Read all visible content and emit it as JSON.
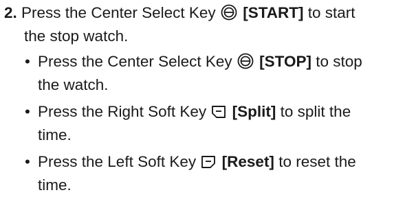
{
  "step": {
    "number": "2.",
    "line1_pre": "Press the Center Select Key",
    "line1_key": "[START]",
    "line1_post": "to start",
    "line2": "the stop watch.",
    "center_key_icon": "center-select-key-icon"
  },
  "bullets": [
    {
      "dot": "•",
      "pre": "Press the Center Select Key",
      "icon": "center-select-key-icon",
      "key": "[STOP]",
      "post": "to stop",
      "cont": "the watch."
    },
    {
      "dot": "•",
      "pre": "Press the Right Soft Key",
      "icon": "right-soft-key-icon",
      "key": "[Split]",
      "post": "to split the",
      "cont": "time."
    },
    {
      "dot": "•",
      "pre": "Press the Left Soft Key",
      "icon": "left-soft-key-icon",
      "key": "[Reset]",
      "post": "to reset the",
      "cont": "time."
    }
  ]
}
